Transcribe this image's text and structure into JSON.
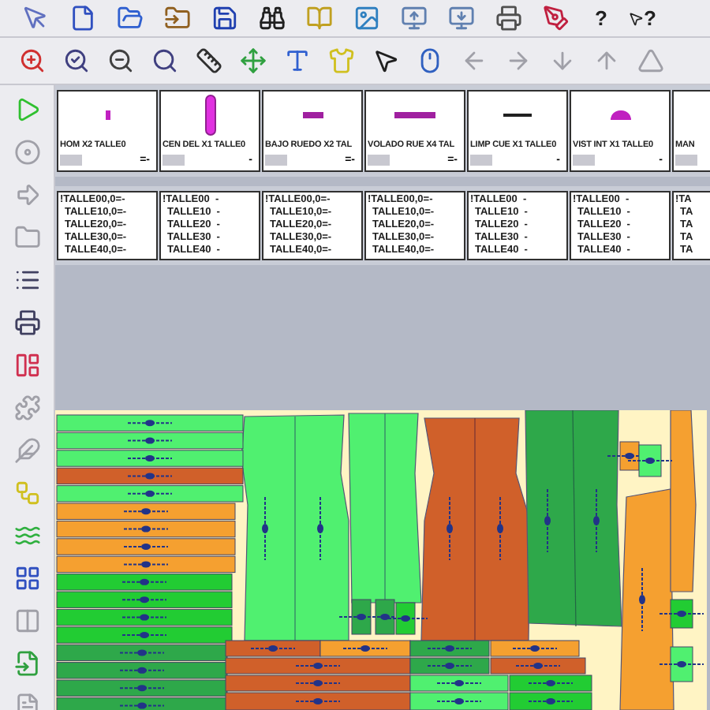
{
  "toolbar_help": {
    "help": "?",
    "context_help": "?"
  },
  "pieces": [
    {
      "name": "HOM X2 TALLE0",
      "mark": "=-",
      "kind": "dot"
    },
    {
      "name": "CEN DEL X1 TALLE0",
      "mark": "-",
      "kind": "dress"
    },
    {
      "name": "BAJO RUEDO X2 TAL",
      "mark": "=-",
      "kind": "bar"
    },
    {
      "name": "VOLADO RUE X4 TAL",
      "mark": "=-",
      "kind": "long-bar"
    },
    {
      "name": "LIMP CUE X1 TALLE0",
      "mark": "-",
      "kind": "line"
    },
    {
      "name": "VIST INT X1 TALLE0",
      "mark": "-",
      "kind": "bump"
    },
    {
      "name": "MAN"
    }
  ],
  "size_lists": [
    {
      "sizes": [
        "!TALLE00,0=-",
        "TALLE10,0=-",
        "TALLE20,0=-",
        "TALLE30,0=-",
        "TALLE40,0=-"
      ]
    },
    {
      "sizes": [
        "!TALLE00  -",
        "TALLE10  -",
        "TALLE20  -",
        "TALLE30  -",
        "TALLE40  -"
      ]
    },
    {
      "sizes": [
        "!TALLE00,0=-",
        "TALLE10,0=-",
        "TALLE20,0=-",
        "TALLE30,0=-",
        "TALLE40,0=-"
      ]
    },
    {
      "sizes": [
        "!TALLE00,0=-",
        "TALLE10,0=-",
        "TALLE20,0=-",
        "TALLE30,0=-",
        "TALLE40,0=-"
      ]
    },
    {
      "sizes": [
        "!TALLE00  -",
        "TALLE10  -",
        "TALLE20  -",
        "TALLE30  -",
        "TALLE40  -"
      ]
    },
    {
      "sizes": [
        "!TALLE00  -",
        "TALLE10  -",
        "TALLE20  -",
        "TALLE30  -",
        "TALLE40  -"
      ]
    },
    {
      "sizes": [
        "!TA",
        "TA",
        "TA",
        "TA",
        "TA"
      ]
    }
  ]
}
